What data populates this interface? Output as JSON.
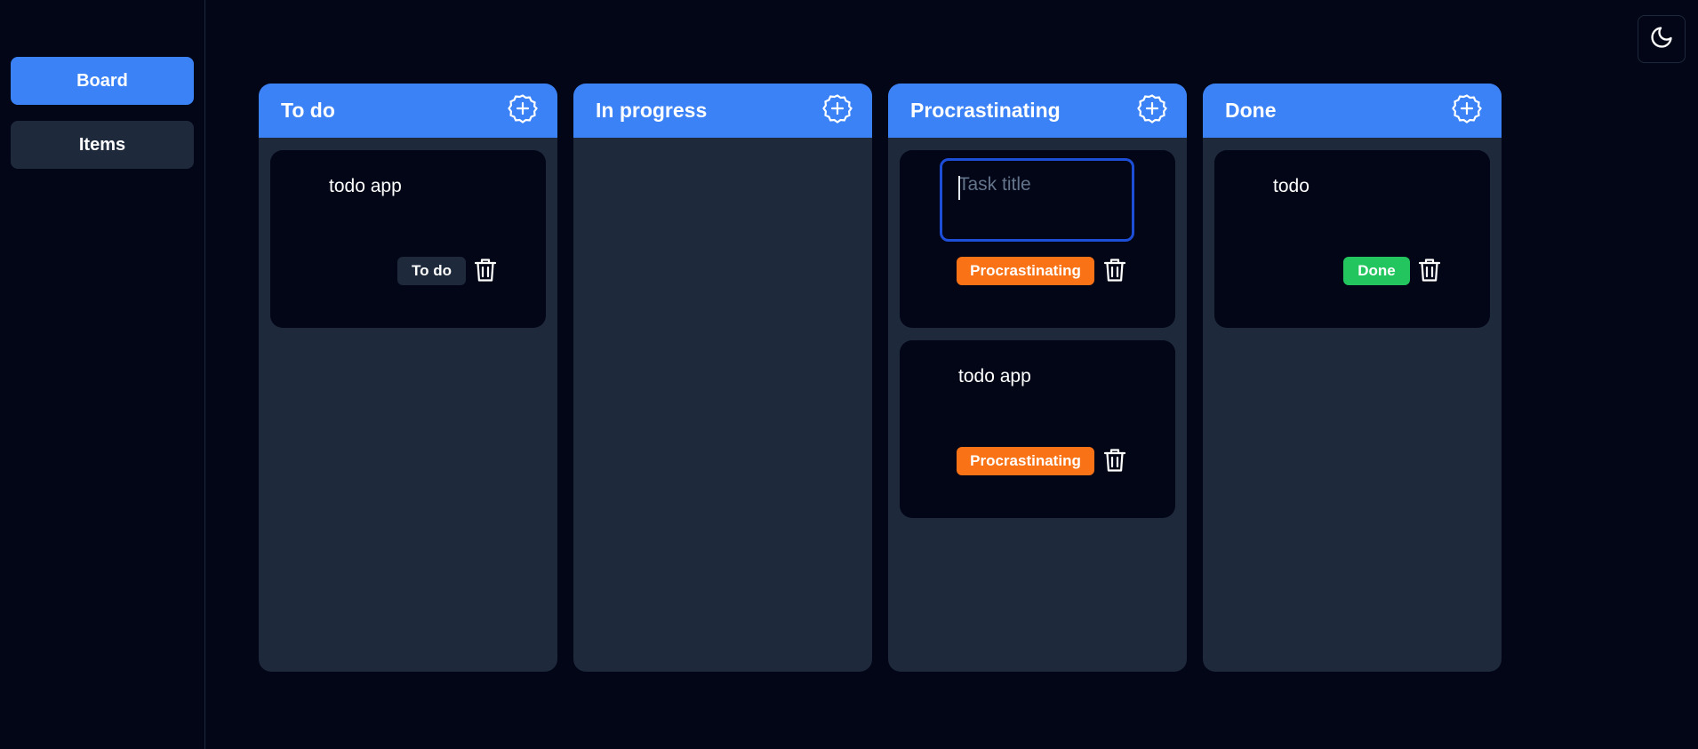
{
  "sidebar": {
    "items": [
      {
        "label": "Board",
        "active": true
      },
      {
        "label": "Items",
        "active": false
      }
    ]
  },
  "theme_toggle": {
    "icon": "moon-icon"
  },
  "colors": {
    "accent": "#3b82f6",
    "todo_badge": "#1e293b",
    "procrastinating_badge": "#f97316",
    "done_badge": "#22c55e",
    "background": "#020617",
    "column_bg": "#1e293b"
  },
  "board": {
    "columns": [
      {
        "title": "To do",
        "cards": [
          {
            "title": "todo app",
            "status": "To do"
          }
        ]
      },
      {
        "title": "In progress",
        "cards": []
      },
      {
        "title": "Procrastinating",
        "cards": [
          {
            "title": "",
            "placeholder": "Task title",
            "editing": true,
            "status": "Procrastinating"
          },
          {
            "title": "todo app",
            "status": "Procrastinating"
          }
        ]
      },
      {
        "title": "Done",
        "cards": [
          {
            "title": "todo",
            "status": "Done"
          }
        ]
      }
    ]
  }
}
